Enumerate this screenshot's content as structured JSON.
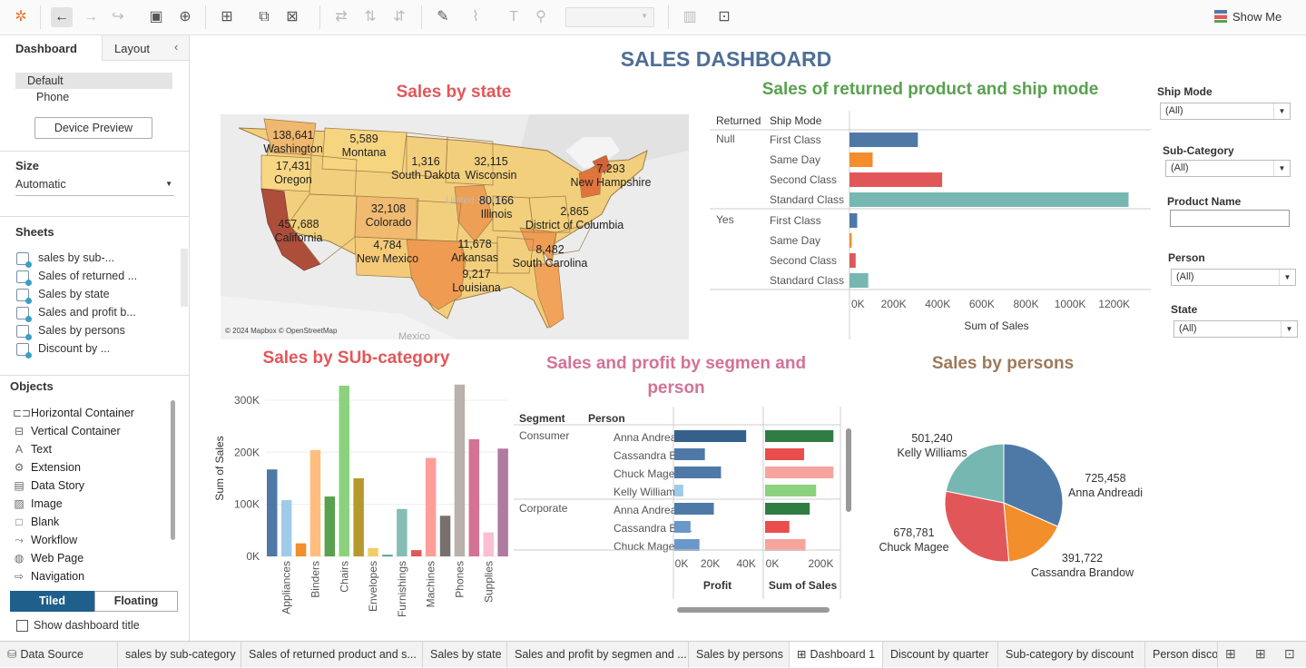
{
  "toolbar": {
    "show_me": "Show Me"
  },
  "left_pane": {
    "tabs": [
      "Dashboard",
      "Layout"
    ],
    "devices": [
      "Default",
      "Phone"
    ],
    "device_preview": "Device Preview",
    "size_header": "Size",
    "size_value": "Automatic",
    "sheets_header": "Sheets",
    "sheets": [
      "sales by sub-...",
      "Sales of returned ...",
      "Sales by state",
      "Sales and profit b...",
      "Sales by persons",
      "Discount by ..."
    ],
    "objects_header": "Objects",
    "objects": [
      "Horizontal Container",
      "Vertical Container",
      "Text",
      "Extension",
      "Data Story",
      "Image",
      "Blank",
      "Workflow",
      "Web Page",
      "Navigation"
    ],
    "tiled": "Tiled",
    "floating": "Floating",
    "show_title": "Show dashboard title"
  },
  "dashboard": {
    "title": "SALES DASHBOARD",
    "map": {
      "title": "Sales by state",
      "credit": "© 2024 Mapbox © OpenStreetMap",
      "faint_labels": [
        "United States",
        "Mexico"
      ],
      "labels": [
        {
          "value": "138,641",
          "state": "Washington"
        },
        {
          "value": "17,431",
          "state": "Oregon"
        },
        {
          "value": "457,688",
          "state": "California"
        },
        {
          "value": "5,589",
          "state": "Montana"
        },
        {
          "value": "1,316",
          "state": "South Dakota"
        },
        {
          "value": "32,115",
          "state": "Wisconsin"
        },
        {
          "value": "32,108",
          "state": "Colorado"
        },
        {
          "value": "80,166",
          "state": "Illinois"
        },
        {
          "value": "4,784",
          "state": "New Mexico"
        },
        {
          "value": "11,678",
          "state": "Arkansas"
        },
        {
          "value": "9,217",
          "state": "Louisiana"
        },
        {
          "value": "8,482",
          "state": "South Carolina"
        },
        {
          "value": "2,865",
          "state": "District of Columbia"
        },
        {
          "value": "7,293",
          "state": "New Hampshire"
        }
      ]
    },
    "filters": {
      "ship_mode": {
        "label": "Ship Mode",
        "value": "(All)"
      },
      "sub_category": {
        "label": "Sub-Category",
        "value": "(All)"
      },
      "product_name": {
        "label": "Product Name",
        "value": ""
      },
      "person": {
        "label": "Person",
        "value": "(All)"
      },
      "state": {
        "label": "State",
        "value": "(All)"
      }
    },
    "pie_labels": [
      {
        "value": "501,240",
        "name": "Kelly Williams"
      },
      {
        "value": "725,458",
        "name": "Anna Andreadi"
      },
      {
        "value": "678,781",
        "name": "Chuck Magee"
      },
      {
        "value": "391,722",
        "name": "Cassandra Brandow"
      }
    ]
  },
  "chart_data": [
    {
      "type": "bar",
      "orientation": "horizontal",
      "title": "Sales of returned product and ship mode",
      "row_headers": [
        "Returned",
        "Ship Mode"
      ],
      "groups": [
        "Null",
        "Yes"
      ],
      "categories": [
        "First Class",
        "Same Day",
        "Second Class",
        "Standard Class"
      ],
      "series": [
        {
          "name": "Null",
          "values": [
            310000,
            105000,
            420000,
            1265000
          ]
        },
        {
          "name": "Yes",
          "values": [
            35000,
            10000,
            28000,
            85000
          ]
        }
      ],
      "colors": [
        "#4e79a7",
        "#f28e2b",
        "#e15759",
        "#76b7b2"
      ],
      "xlabel": "Sum of Sales",
      "xticks": [
        "0K",
        "200K",
        "400K",
        "600K",
        "800K",
        "1000K",
        "1200K"
      ],
      "xlim": [
        0,
        1300000
      ]
    },
    {
      "type": "bar",
      "title": "Sales by SUb-category",
      "ylabel": "Sum of Sales",
      "yticks": [
        "0K",
        "100K",
        "200K",
        "300K"
      ],
      "ylim": [
        0,
        340000
      ],
      "x_tick_labels": [
        "Appliances",
        "Binders",
        "Chairs",
        "Envelopes",
        "Furnishings",
        "Machines",
        "Phones",
        "Supplies"
      ],
      "values": [
        167000,
        108000,
        25000,
        204000,
        115000,
        328000,
        150000,
        16000,
        3000,
        91000,
        12000,
        189000,
        78000,
        330000,
        225000,
        46000,
        207000
      ],
      "colors": [
        "#4e79a7",
        "#a0cbe8",
        "#f28e2b",
        "#ffbe7d",
        "#59a14f",
        "#8cd17d",
        "#b6992d",
        "#f1ce63",
        "#499894",
        "#86bcb6",
        "#e15759",
        "#ff9d9a",
        "#79706e",
        "#bab0ac",
        "#d37295",
        "#fabfd2",
        "#b07aa1"
      ]
    },
    {
      "type": "bar",
      "orientation": "horizontal",
      "title": "Sales and profit by segmen and person",
      "row_headers": [
        "Segment",
        "Person"
      ],
      "rows": [
        {
          "segment": "Consumer",
          "person": "Anna Andreadi",
          "profit": 40000,
          "sales": 245000
        },
        {
          "segment": "",
          "person": "Cassandra Bra..",
          "profit": 17000,
          "sales": 140000
        },
        {
          "segment": "",
          "person": "Chuck Magee",
          "profit": 26000,
          "sales": 245000
        },
        {
          "segment": "",
          "person": "Kelly Williams",
          "profit": 5000,
          "sales": 183000
        },
        {
          "segment": "Corporate",
          "person": "Anna Andreadi",
          "profit": 22000,
          "sales": 160000
        },
        {
          "segment": "",
          "person": "Cassandra Bra..",
          "profit": 9000,
          "sales": 87000
        },
        {
          "segment": "",
          "person": "Chuck Magee",
          "profit": 14000,
          "sales": 145000
        }
      ],
      "profit_xticks": [
        "0K",
        "20K",
        "40K"
      ],
      "sales_xticks": [
        "0K",
        "200K"
      ],
      "profit_xlabel": "Profit",
      "sales_xlabel": "Sum of Sales"
    },
    {
      "type": "pie",
      "title": "Sales by persons",
      "labels": [
        "Anna Andreadi",
        "Cassandra Brandow",
        "Chuck Magee",
        "Kelly Williams"
      ],
      "values": [
        725458,
        391722,
        678781,
        501240
      ],
      "colors": [
        "#4e79a7",
        "#f28e2b",
        "#e15759",
        "#76b7b2"
      ]
    }
  ],
  "bottom_tabs": [
    "Data Source",
    "sales by sub-category",
    "Sales of returned product and s...",
    "Sales by state",
    "Sales and profit by segmen and ...",
    "Sales by persons",
    "Dashboard 1",
    "Discount by quarter",
    "Sub-category by discount",
    "Person disco"
  ],
  "active_tab": "Dashboard 1"
}
